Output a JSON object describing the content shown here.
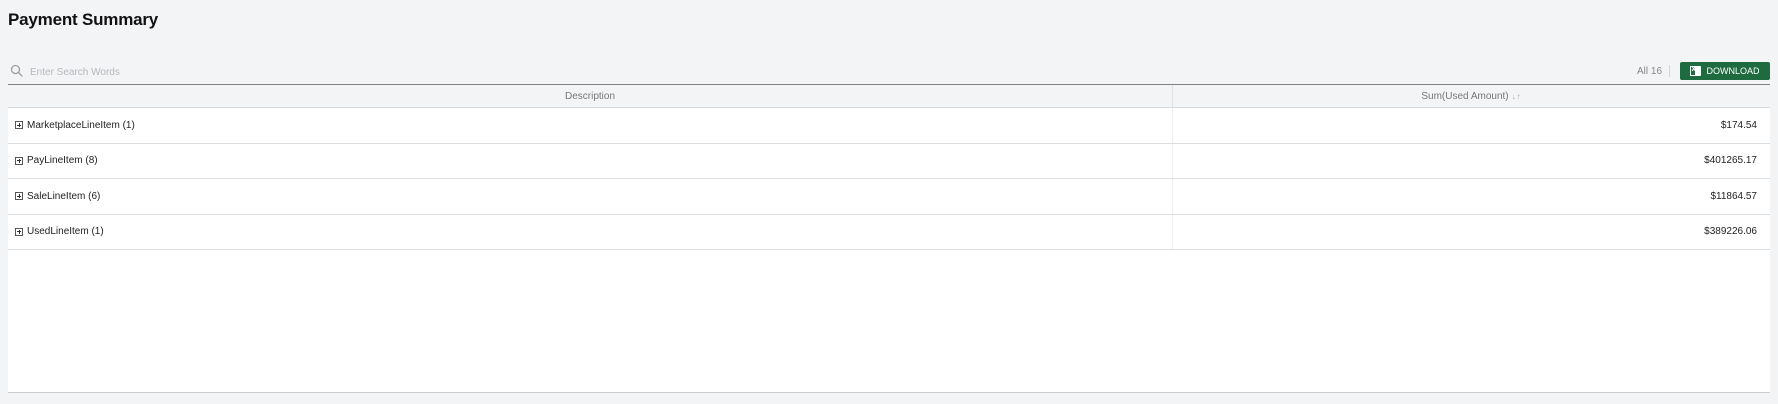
{
  "page": {
    "title": "Payment Summary"
  },
  "toolbar": {
    "search_placeholder": "Enter Search Words",
    "search_icon": "search-icon",
    "count_text": "All 16",
    "download_label": "DOWNLOAD",
    "download_icon": "excel-icon",
    "download_color": "#1e6b3f"
  },
  "table": {
    "columns": [
      {
        "label": "Description"
      },
      {
        "label": "Sum(Used Amount)",
        "sort_indicator": "↓↑"
      }
    ],
    "rows": [
      {
        "description": "MarketplaceLineItem (1)",
        "sum": "$174.54"
      },
      {
        "description": "PayLineItem (8)",
        "sum": "$401265.17"
      },
      {
        "description": "SaleLineItem (6)",
        "sum": "$11864.57"
      },
      {
        "description": "UsedLineItem (1)",
        "sum": "$389226.06"
      }
    ]
  }
}
